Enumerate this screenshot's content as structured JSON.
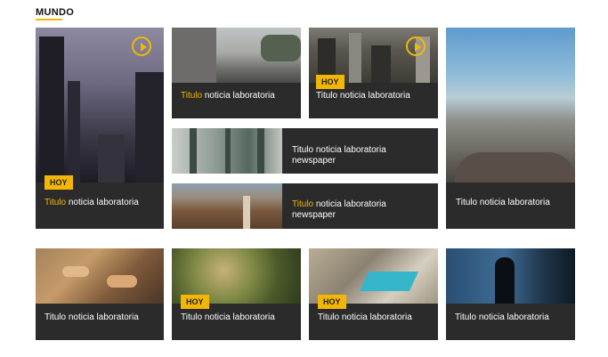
{
  "section": {
    "title": "MUNDO",
    "accent": "#f2b705"
  },
  "cards": [
    {
      "title_hl": "Titulo",
      "title_rest": " noticia laboratoria",
      "badge": "HOY",
      "video": true
    },
    {
      "title_hl": "Titulo",
      "title_rest": " noticia laboratoria",
      "badge": "",
      "video": false
    },
    {
      "title_hl": "",
      "title_rest": "Titulo noticia laboratoria",
      "badge": "HOY",
      "video": true
    },
    {
      "title_hl": "",
      "title_rest": "Titulo noticia laboratoria",
      "badge": "",
      "video": false
    },
    {
      "title_hl": "",
      "title_rest": "Titulo noticia laboratoria newspaper",
      "badge": "",
      "video": false
    },
    {
      "title_hl": "Titulo",
      "title_rest": " noticia laboratoria newspaper",
      "badge": "",
      "video": false
    },
    {
      "title_hl": "",
      "title_rest": "Titulo noticia laboratoria",
      "badge": "",
      "video": false
    },
    {
      "title_hl": "",
      "title_rest": "Titulo noticia laboratoria",
      "badge": "HOY",
      "video": false
    },
    {
      "title_hl": "",
      "title_rest": "Titulo noticia laboratoria",
      "badge": "HOY",
      "video": false
    },
    {
      "title_hl": "",
      "title_rest": "Titulo noticia laboratoria",
      "badge": "",
      "video": false
    }
  ]
}
